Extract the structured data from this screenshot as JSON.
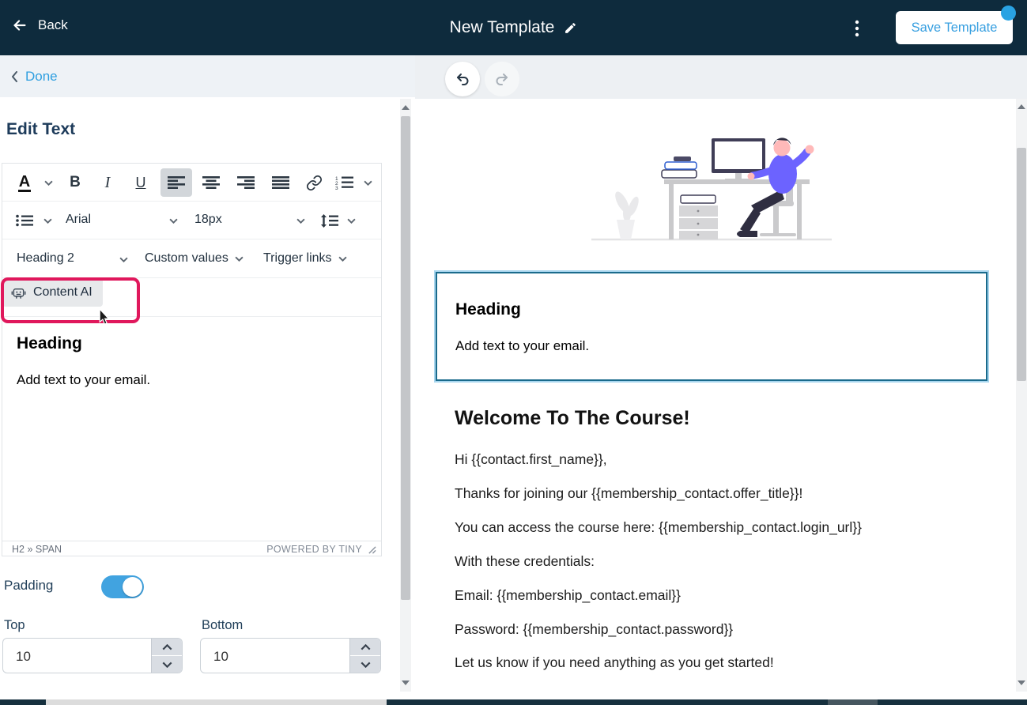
{
  "topbar": {
    "back_label": "Back",
    "title": "New Template",
    "save_label": "Save Template"
  },
  "left_panel": {
    "done_label": "Done",
    "title": "Edit Text",
    "toolbar": {
      "font_name": "Arial",
      "font_size": "18px",
      "block_format": "Heading 2",
      "custom_values": "Custom values",
      "trigger_links": "Trigger links",
      "content_ai": "Content AI"
    },
    "editor": {
      "heading": "Heading",
      "body": "Add text to your email.",
      "element_path": "H2 » SPAN",
      "powered_by": "POWERED BY TINY"
    },
    "padding_section": {
      "label": "Padding",
      "toggle_on": true,
      "top_label": "Top",
      "top_value": "10",
      "bottom_label": "Bottom",
      "bottom_value": "10"
    }
  },
  "canvas": {
    "selected_block": {
      "heading": "Heading",
      "body": "Add text to your email."
    },
    "email_title": "Welcome To The Course!",
    "paragraphs": [
      "Hi {{contact.first_name}},",
      "Thanks for joining our {{membership_contact.offer_title}}!",
      "You can access the course here: {{membership_contact.login_url}}",
      "With these credentials:",
      "Email: {{membership_contact.email}}",
      "Password: {{membership_contact.password}}",
      "Let us know if you need anything as you get started!"
    ]
  },
  "icons": {
    "back": "left-arrow",
    "edit_title": "pencil",
    "menu": "kebab-vertical",
    "text_color": "underlined-A",
    "bold": "B",
    "italic": "I",
    "underline": "U",
    "align": [
      "left",
      "center",
      "right",
      "justify"
    ],
    "link": "chain",
    "ordered_list": "numbered-lines",
    "bullet_list": "dotted-lines",
    "line_height": "vertical-arrows-lines",
    "content_ai": "robot",
    "undo": "curved-arrow-left",
    "redo": "curved-arrow-right",
    "resize": "diagonal-grip"
  },
  "colors": {
    "topbar_bg": "#0e2b3d",
    "accent_blue": "#2f9fe0",
    "highlight_pink": "#e0185c",
    "selection_border": "#1b6b8c",
    "toggle_on": "#41a3e0"
  }
}
